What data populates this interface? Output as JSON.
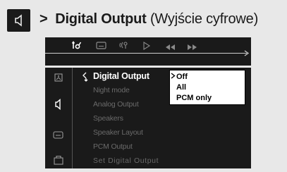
{
  "header": {
    "arrow": ">",
    "title_bold": "Digital Output",
    "title_note": "(Wyjście cyfrowe)"
  },
  "toolbar": {
    "icons": [
      "settings-tab-icon",
      "subtitle-icon",
      "audio-icon",
      "play-icon",
      "rewind-icon",
      "fast-forward-icon"
    ]
  },
  "sidebar": {
    "icons": [
      "picture-icon",
      "speaker-icon",
      "subtitle-icon",
      "lock-icon"
    ]
  },
  "menu": {
    "items": [
      "Digital Output",
      "Night mode",
      "Analog Output",
      "Speakers",
      "Speaker Layout",
      "PCM Output",
      "Set Digital Output"
    ],
    "active_index": 0
  },
  "options": {
    "items": [
      "Off",
      "All",
      "PCM only"
    ],
    "selected_index": 0
  },
  "colors": {
    "panel_bg": "#1a1a1a",
    "page_bg": "#e8e8e8",
    "inactive_text": "#6a6a6a",
    "active_text": "#ffffff"
  }
}
